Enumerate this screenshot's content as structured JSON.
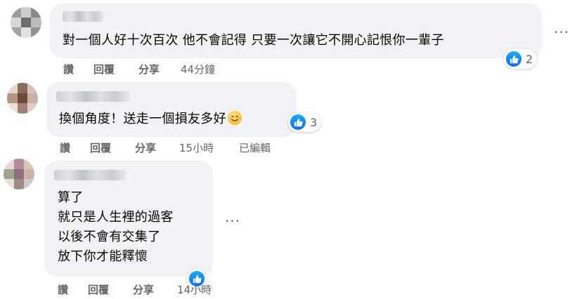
{
  "comments": [
    {
      "text": "對一個人好十次百次 他不會記得 只要一次讓它不開心記恨你一輩子",
      "likes": "2",
      "actions": {
        "like": "讚",
        "reply": "回覆",
        "share": "分享",
        "time": "44分鐘"
      }
    },
    {
      "text": "換個角度！送走一個損友多好",
      "emoji": "smiling-face",
      "likes": "3",
      "actions": {
        "like": "讚",
        "reply": "回覆",
        "share": "分享",
        "time": "15小時",
        "edited": "已編輯"
      }
    },
    {
      "lines": [
        "算了",
        "就只是人生裡的過客",
        "以後不會有交集了",
        "放下你才能釋懷"
      ],
      "actions": {
        "like": "讚",
        "reply": "回覆",
        "share": "分享",
        "time": "14小時"
      }
    }
  ],
  "more_menu": "···"
}
